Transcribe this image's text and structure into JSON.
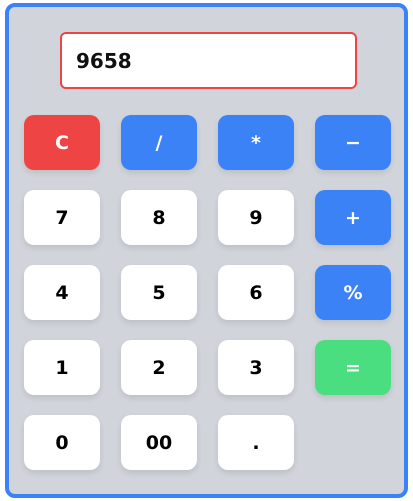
{
  "display": {
    "value": "9658"
  },
  "keys": {
    "clear": "C",
    "divide": "/",
    "multiply": "*",
    "subtract": "−",
    "seven": "7",
    "eight": "8",
    "nine": "9",
    "add": "+",
    "four": "4",
    "five": "5",
    "six": "6",
    "percent": "%",
    "one": "1",
    "two": "2",
    "three": "3",
    "equals": "=",
    "zero": "0",
    "double_zero": "00",
    "decimal": "."
  },
  "colors": {
    "frame_border": "#3b82f6",
    "frame_bg": "#d1d5db",
    "display_border": "#ef4444",
    "clear_key": "#ef4444",
    "operator_key": "#3b82f6",
    "equals_key": "#4ade80",
    "digit_key": "#ffffff"
  }
}
